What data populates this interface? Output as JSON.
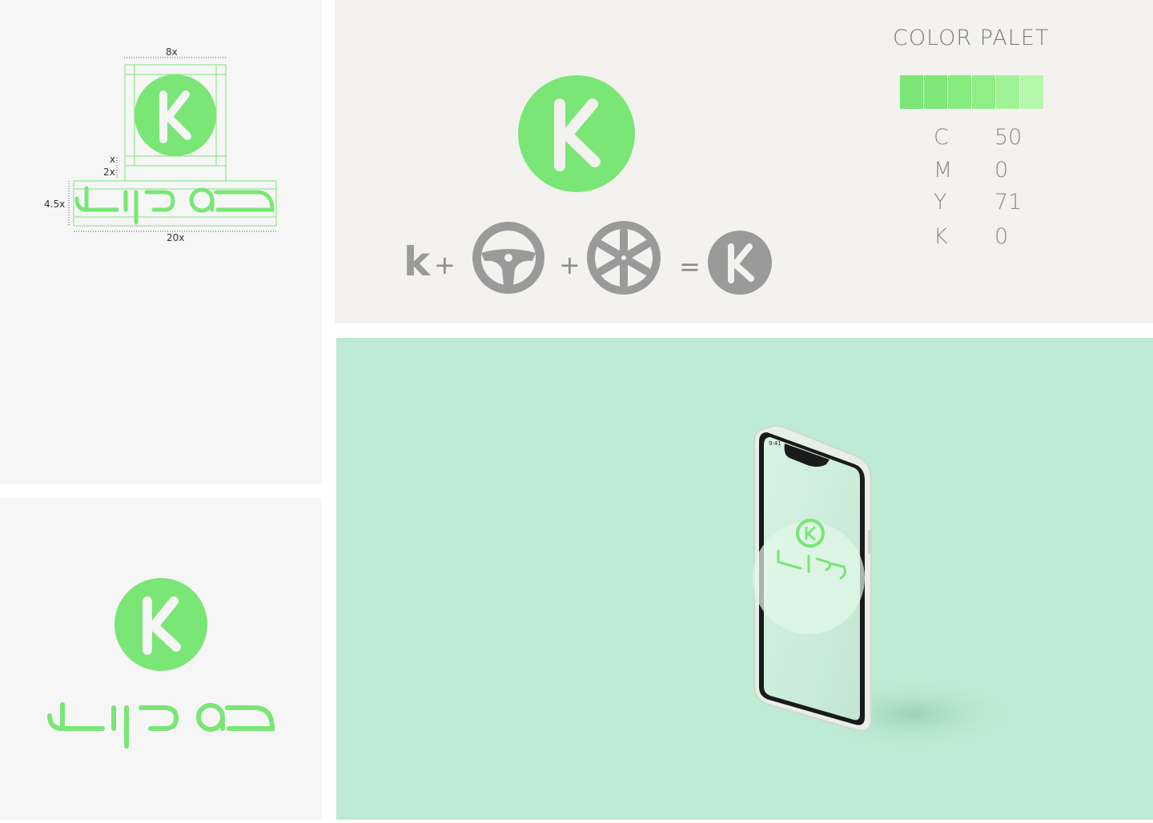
{
  "construction": {
    "width_label": "8x",
    "gap_x_label": "x",
    "gap_2x_label": "2x",
    "height_label": "4.5x",
    "total_width_label": "20x"
  },
  "palette": {
    "title": "COLOR PALET",
    "swatch_colors": [
      "#79e676",
      "#7fe879",
      "#86ec7e",
      "#8fef86",
      "#9ef394",
      "#b5f8ab"
    ],
    "cmyk": [
      {
        "channel": "C",
        "value": "50"
      },
      {
        "channel": "M",
        "value": "0"
      },
      {
        "channel": "Y",
        "value": "71"
      },
      {
        "channel": "K",
        "value": "0"
      }
    ]
  },
  "concept": {
    "letter": "k",
    "plus": "+",
    "equals": "=",
    "icons": [
      "steering-wheel-icon",
      "car-wheel-icon",
      "k-logo-gray-icon"
    ]
  },
  "phone": {
    "time": "9:41"
  },
  "colors": {
    "brand_green": "#79e676",
    "concept_gray": "#9a9a9a",
    "mockup_bg": "#bdebd3"
  }
}
